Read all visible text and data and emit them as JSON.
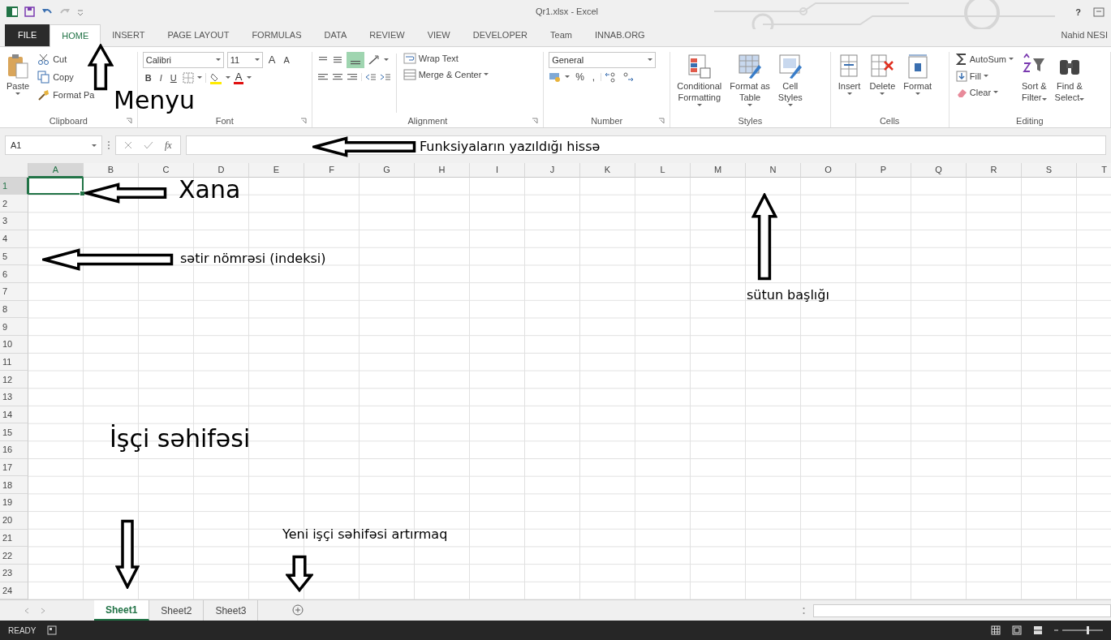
{
  "title_bar": {
    "title": "Qr1.xlsx - Excel",
    "help": "?"
  },
  "ribbon_tabs": [
    {
      "label": "FILE",
      "kind": "file",
      "selected": false
    },
    {
      "label": "HOME",
      "kind": "tab",
      "selected": true
    },
    {
      "label": "INSERT",
      "kind": "tab",
      "selected": false
    },
    {
      "label": "PAGE LAYOUT",
      "kind": "tab",
      "selected": false
    },
    {
      "label": "FORMULAS",
      "kind": "tab",
      "selected": false
    },
    {
      "label": "DATA",
      "kind": "tab",
      "selected": false
    },
    {
      "label": "REVIEW",
      "kind": "tab",
      "selected": false
    },
    {
      "label": "VIEW",
      "kind": "tab",
      "selected": false
    },
    {
      "label": "DEVELOPER",
      "kind": "tab",
      "selected": false
    },
    {
      "label": "Team",
      "kind": "tab",
      "selected": false
    },
    {
      "label": "INNAB.ORG",
      "kind": "tab",
      "selected": false
    }
  ],
  "user": "Nahid NESI",
  "ribbon": [
    {
      "kind": "clipboard",
      "label": "Clipboard",
      "paste": "Paste",
      "items": [
        "Cut",
        "Copy",
        "Format Pa"
      ]
    },
    {
      "kind": "font",
      "label": "Font",
      "font": "Calibri",
      "size": "11",
      "grow": [
        "A",
        "A"
      ],
      "styles": [
        "B",
        "I",
        "U"
      ],
      "color_label": "A"
    },
    {
      "kind": "alignment",
      "label": "Alignment",
      "items": [
        "Wrap Text",
        "Merge & Center"
      ]
    },
    {
      "kind": "number",
      "label": "Number",
      "format": "General",
      "symbols": [
        "%",
        ","
      ]
    },
    {
      "kind": "styles",
      "label": "Styles",
      "buttons": [
        {
          "lines": [
            "Conditional",
            "Formatting"
          ]
        },
        {
          "lines": [
            "Format as",
            "Table"
          ]
        },
        {
          "lines": [
            "Cell",
            "Styles"
          ]
        }
      ]
    },
    {
      "kind": "cells",
      "label": "Cells",
      "buttons": [
        {
          "lines": [
            "Insert"
          ]
        },
        {
          "lines": [
            "Delete"
          ]
        },
        {
          "lines": [
            "Format"
          ]
        }
      ]
    },
    {
      "kind": "editing",
      "label": "Editing",
      "items": [
        "AutoSum",
        "Fill",
        "Clear"
      ],
      "buttons": [
        {
          "lines": [
            "Sort &",
            "Filter"
          ]
        },
        {
          "lines": [
            "Find &",
            "Select"
          ]
        }
      ]
    }
  ],
  "formula_bar": {
    "name_box": "A1",
    "fx": "fx"
  },
  "columns": [
    {
      "label": "A",
      "selected": true
    },
    {
      "label": "B",
      "selected": false
    },
    {
      "label": "C",
      "selected": false
    },
    {
      "label": "D",
      "selected": false
    },
    {
      "label": "E",
      "selected": false
    },
    {
      "label": "F",
      "selected": false
    },
    {
      "label": "G",
      "selected": false
    },
    {
      "label": "H",
      "selected": false
    },
    {
      "label": "I",
      "selected": false
    },
    {
      "label": "J",
      "selected": false
    },
    {
      "label": "K",
      "selected": false
    },
    {
      "label": "L",
      "selected": false
    },
    {
      "label": "M",
      "selected": false
    },
    {
      "label": "N",
      "selected": false
    },
    {
      "label": "O",
      "selected": false
    },
    {
      "label": "P",
      "selected": false
    },
    {
      "label": "Q",
      "selected": false
    },
    {
      "label": "R",
      "selected": false
    },
    {
      "label": "S",
      "selected": false
    },
    {
      "label": "T",
      "selected": false
    }
  ],
  "rows": [
    {
      "label": "1",
      "selected": true
    },
    {
      "label": "2",
      "selected": false
    },
    {
      "label": "3",
      "selected": false
    },
    {
      "label": "4",
      "selected": false
    },
    {
      "label": "5",
      "selected": false
    },
    {
      "label": "6",
      "selected": false
    },
    {
      "label": "7",
      "selected": false
    },
    {
      "label": "8",
      "selected": false
    },
    {
      "label": "9",
      "selected": false
    },
    {
      "label": "10",
      "selected": false
    },
    {
      "label": "11",
      "selected": false
    },
    {
      "label": "12",
      "selected": false
    },
    {
      "label": "13",
      "selected": false
    },
    {
      "label": "14",
      "selected": false
    },
    {
      "label": "15",
      "selected": false
    },
    {
      "label": "16",
      "selected": false
    },
    {
      "label": "17",
      "selected": false
    },
    {
      "label": "18",
      "selected": false
    },
    {
      "label": "19",
      "selected": false
    },
    {
      "label": "20",
      "selected": false
    },
    {
      "label": "21",
      "selected": false
    },
    {
      "label": "22",
      "selected": false
    },
    {
      "label": "23",
      "selected": false
    },
    {
      "label": "24",
      "selected": false
    }
  ],
  "sheets": [
    {
      "label": "Sheet1",
      "selected": true
    },
    {
      "label": "Sheet2",
      "selected": false
    },
    {
      "label": "Sheet3",
      "selected": false
    }
  ],
  "status_bar": {
    "status": "READY"
  },
  "annotations": [
    {
      "text": "Menyu",
      "kind": "up"
    },
    {
      "text": "Funksiyaların yazıldığı hissə",
      "kind": "left"
    },
    {
      "text": "Xana",
      "kind": "left"
    },
    {
      "text": "sətir nömrəsi (indeksi)",
      "kind": "left"
    },
    {
      "text": "sütun başlığı",
      "kind": "up"
    },
    {
      "text": "İşçi səhifəsi",
      "kind": "down"
    },
    {
      "text": "Yeni işçi səhifəsi artırmaq",
      "kind": "down"
    }
  ]
}
